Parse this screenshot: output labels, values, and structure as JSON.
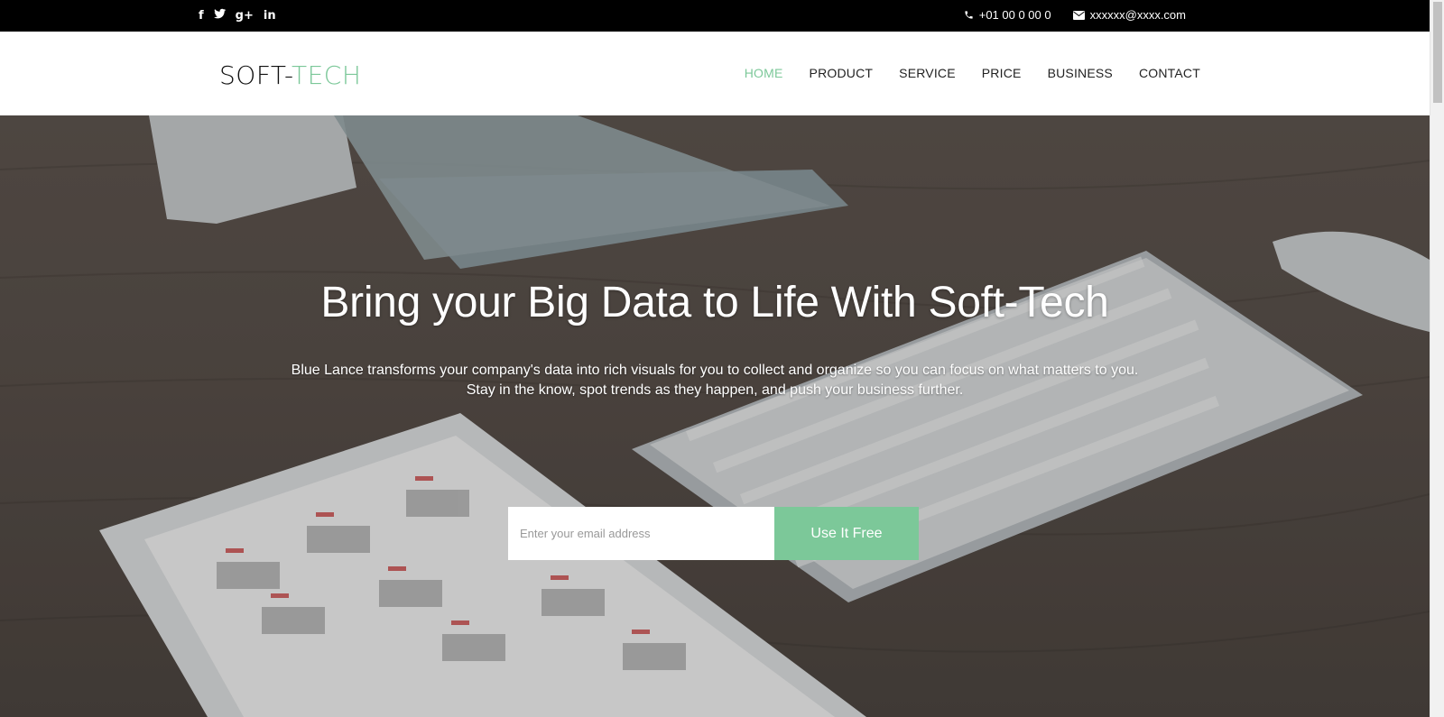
{
  "topbar": {
    "social": [
      {
        "icon": "facebook-icon",
        "glyph": "f"
      },
      {
        "icon": "twitter-icon",
        "glyph": "ᴛ"
      },
      {
        "icon": "google-plus-icon",
        "glyph": "g+"
      },
      {
        "icon": "linkedin-icon",
        "glyph": "in"
      }
    ],
    "phone": "+01 00 0 00 0",
    "email": "xxxxxx@xxxx.com"
  },
  "nav": {
    "logo_main": "SOFT-",
    "logo_accent": "TECH",
    "items": [
      {
        "label": "HOME",
        "active": true
      },
      {
        "label": "PRODUCT",
        "active": false
      },
      {
        "label": "SERVICE",
        "active": false
      },
      {
        "label": "PRICE",
        "active": false
      },
      {
        "label": "BUSINESS",
        "active": false
      },
      {
        "label": "CONTACT",
        "active": false
      }
    ]
  },
  "hero": {
    "title": "Bring your Big Data to Life With Soft-Tech",
    "subtitle": "Blue Lance transforms your company's data into rich visuals for you to collect and organize so you can focus on what matters to you. Stay in the know, spot trends as they happen, and push your business further.",
    "email_placeholder": "Enter your email address",
    "cta_label": "Use It Free"
  },
  "colors": {
    "accent": "#7cc899",
    "topbar_bg": "#000000"
  }
}
